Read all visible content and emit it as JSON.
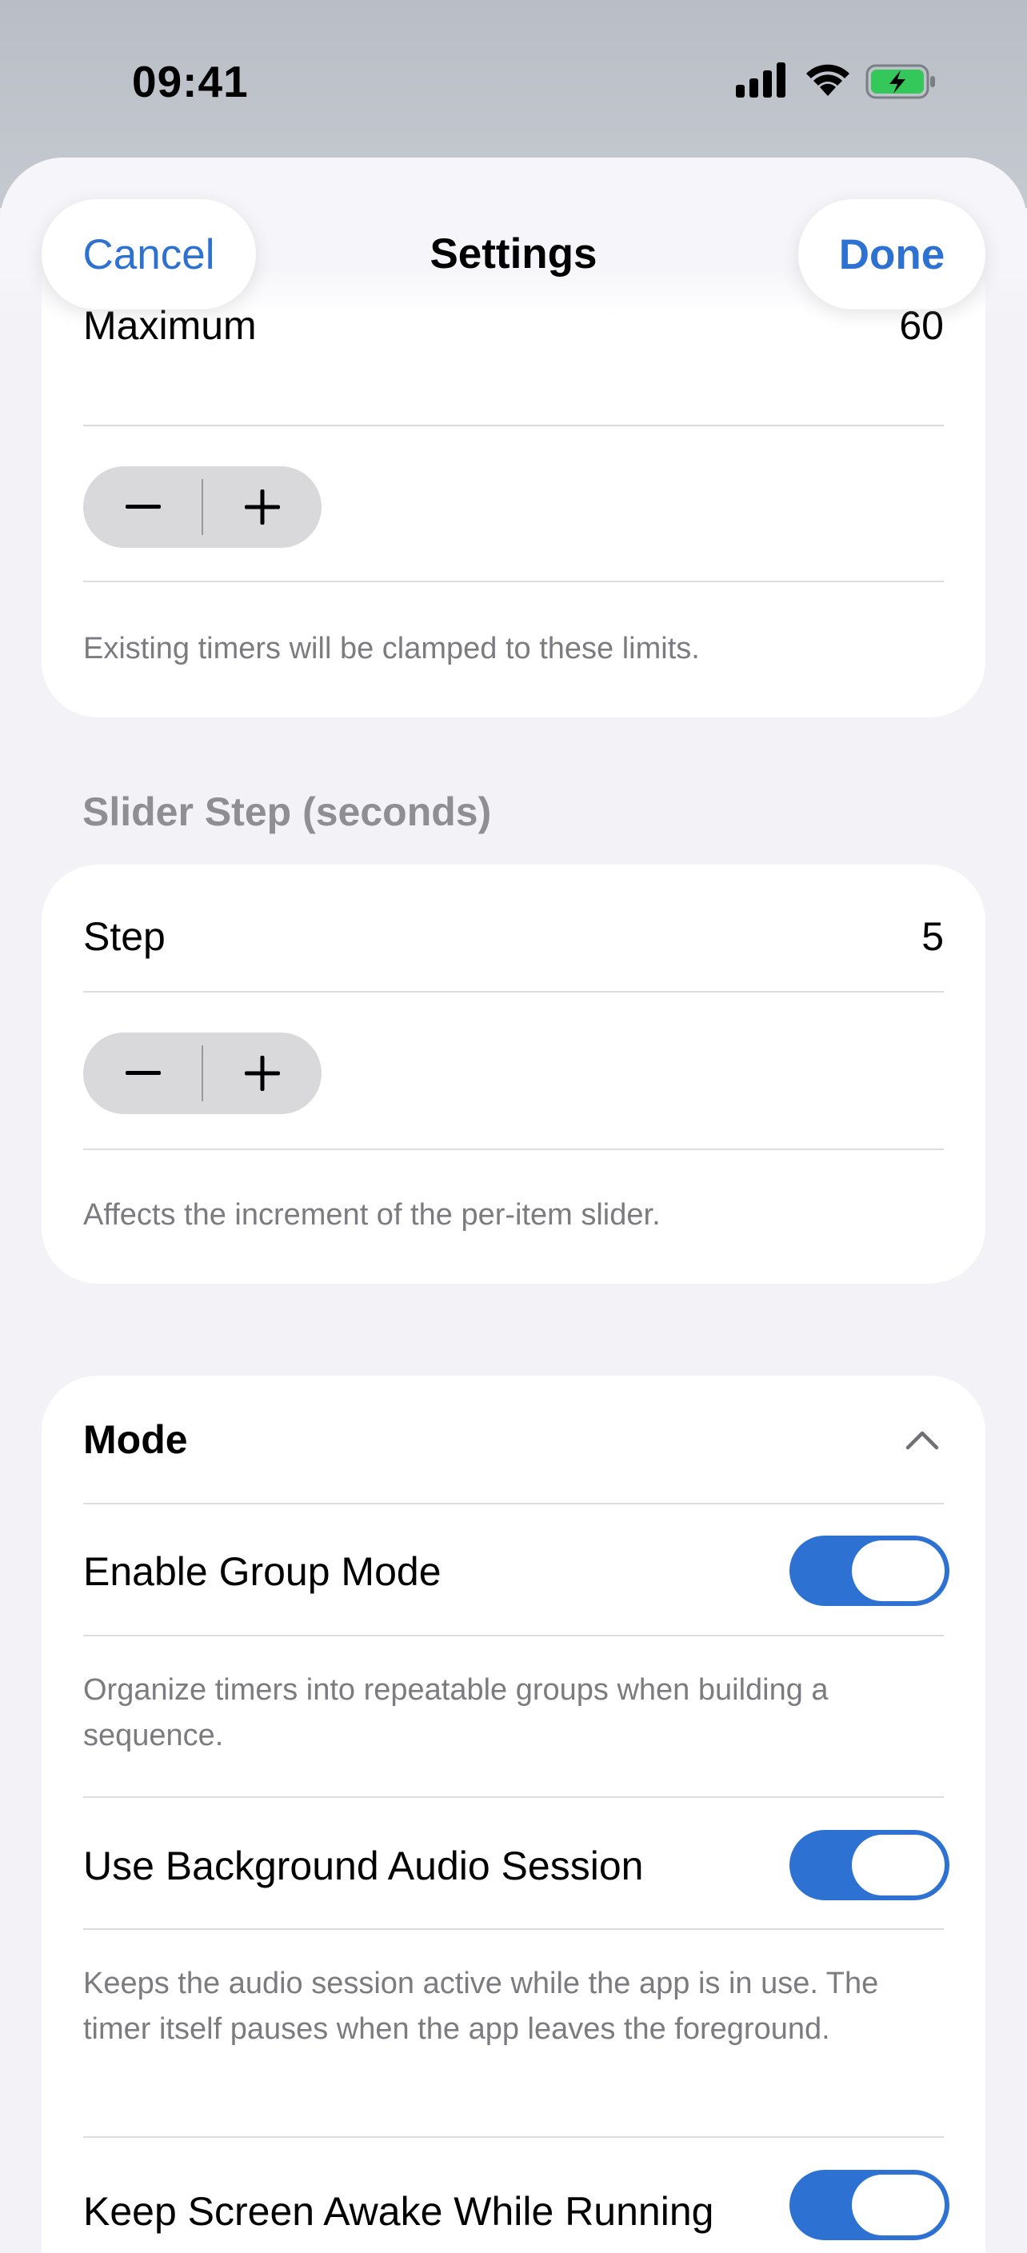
{
  "status_bar": {
    "time": "09:41"
  },
  "nav": {
    "title": "Settings",
    "cancel_label": "Cancel",
    "done_label": "Done"
  },
  "limits_section": {
    "maximum_label": "Maximum",
    "maximum_value": "60",
    "footer": "Existing timers will be clamped to these limits."
  },
  "step_section": {
    "header": "Slider Step (seconds)",
    "step_label": "Step",
    "step_value": "5",
    "footer": "Affects the increment of the per-item slider."
  },
  "mode_section": {
    "title": "Mode",
    "items": [
      {
        "label": "Enable Group Mode",
        "enabled": true,
        "description": "Organize timers into repeatable groups when building a sequence."
      },
      {
        "label": "Use Background Audio Session",
        "enabled": true,
        "description": "Keeps the audio session active while the app is in use. The timer itself pauses when the app leaves the foreground."
      },
      {
        "label": "Keep Screen Awake While Running",
        "enabled": true
      }
    ]
  },
  "colors": {
    "accent": "#2d72d2",
    "battery_green": "#34c759",
    "background": "#f2f2f7"
  }
}
